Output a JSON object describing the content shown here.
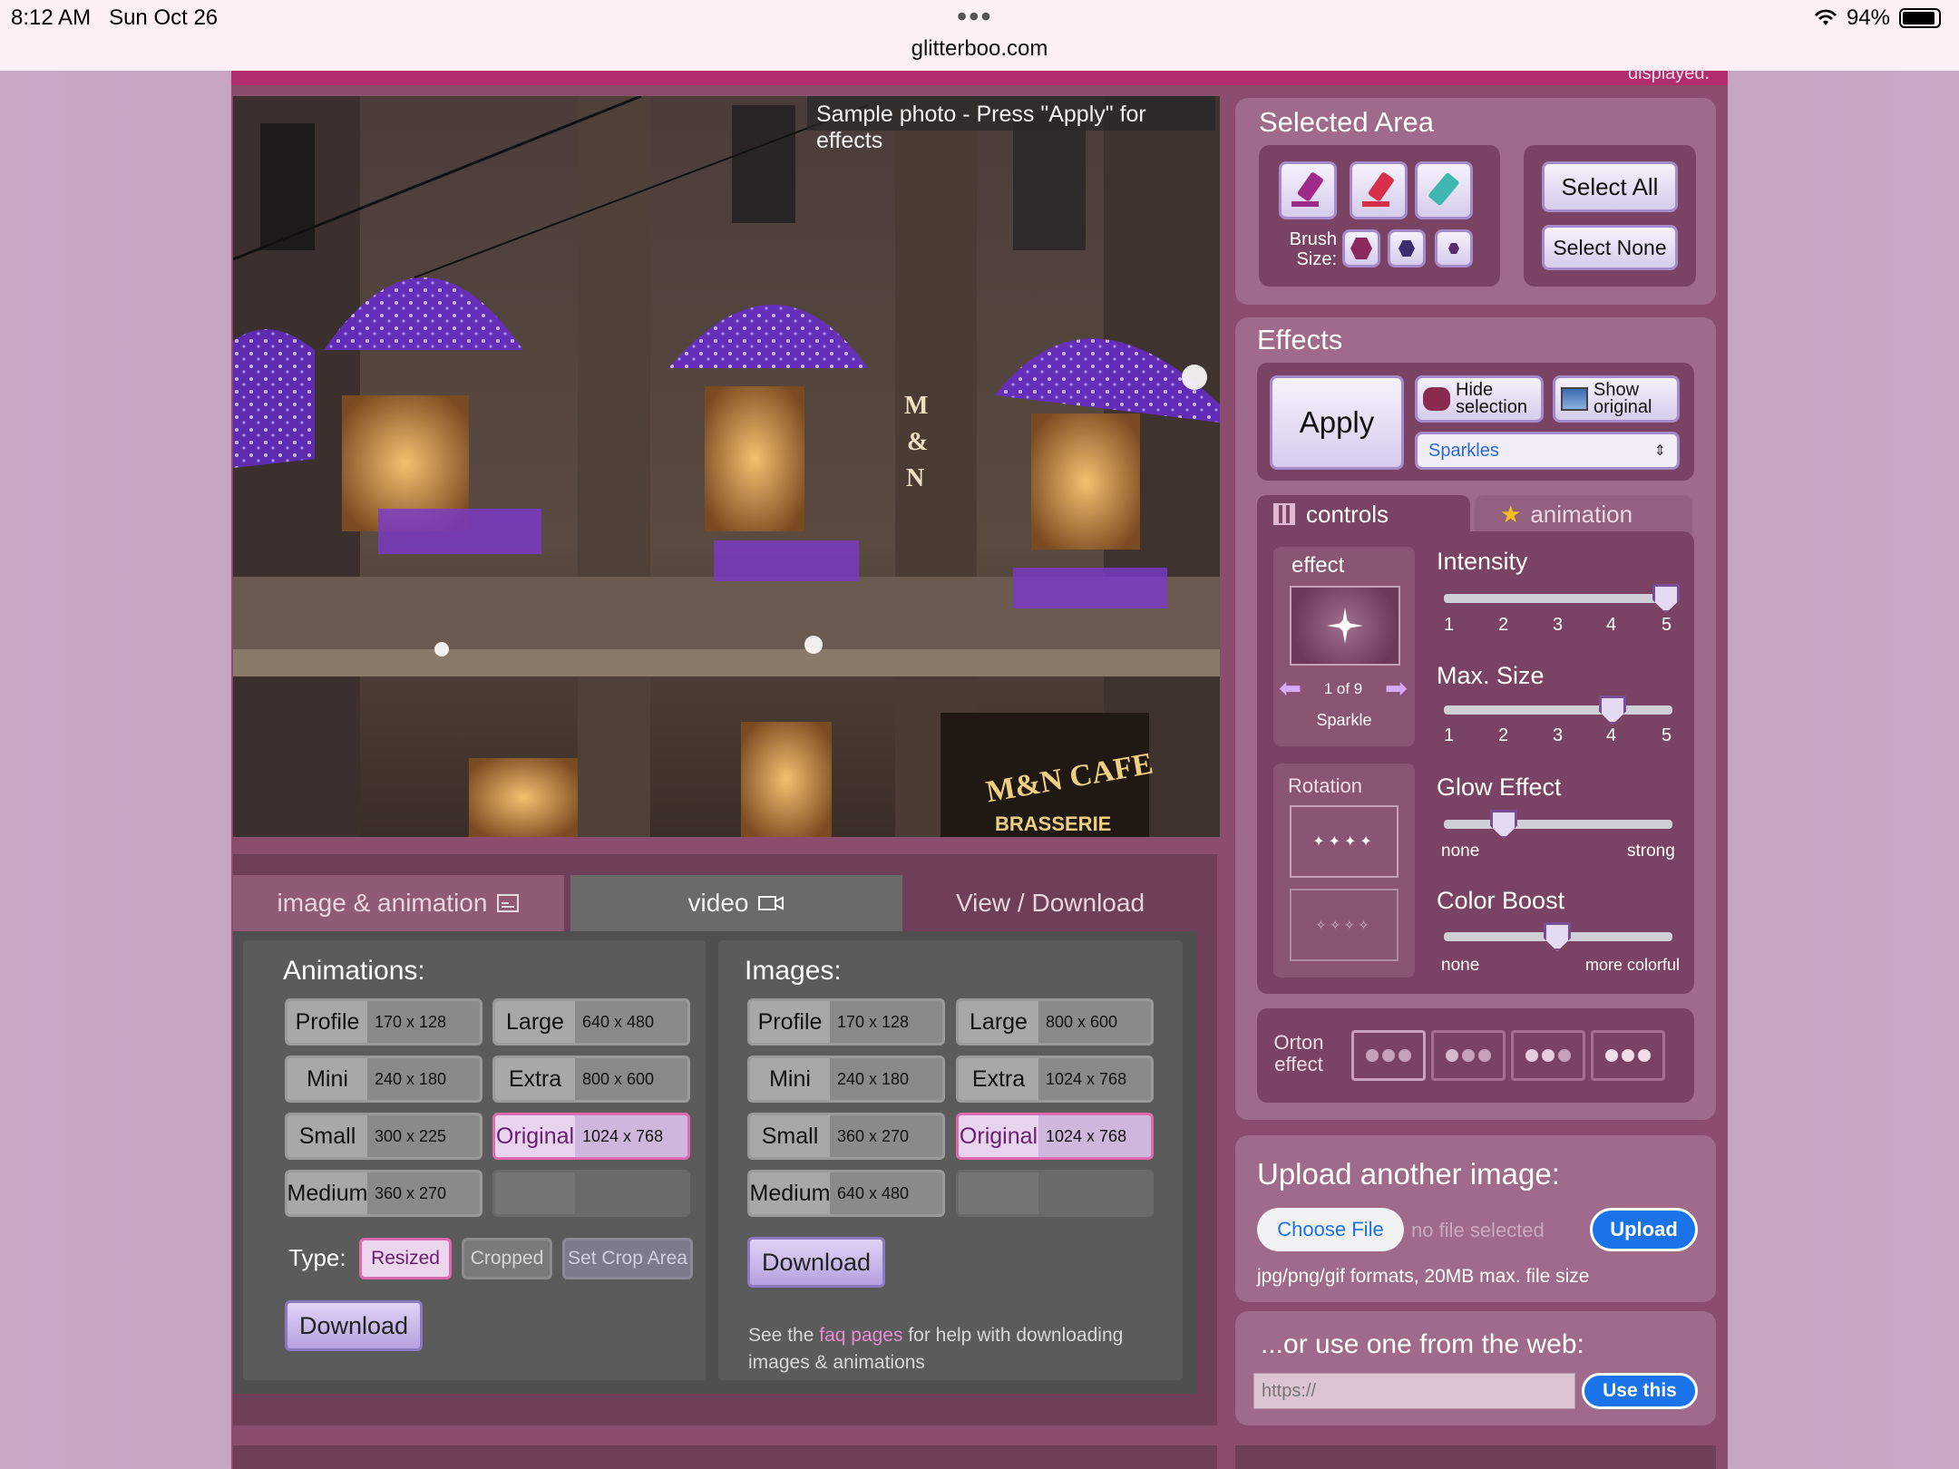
{
  "status_bar": {
    "time": "8:12 AM",
    "date": "Sun Oct 26",
    "dots": "•••",
    "url": "glitterboo.com",
    "battery": "94%"
  },
  "site": {
    "displayed_text": "displayed.",
    "photo_caption": "Sample photo - Press \"Apply\" for effects",
    "tabs": [
      {
        "label": "image & animation",
        "icon": "image-icon"
      },
      {
        "label": "video",
        "icon": "video-icon"
      },
      {
        "label": "View / Download"
      }
    ],
    "animations": {
      "heading": "Animations:",
      "sizes": [
        {
          "name": "Profile",
          "dims": "170 x 128"
        },
        {
          "name": "Large",
          "dims": "640 x 480"
        },
        {
          "name": "Mini",
          "dims": "240 x 180"
        },
        {
          "name": "Extra",
          "dims": "800 x 600"
        },
        {
          "name": "Small",
          "dims": "300 x 225"
        },
        {
          "name": "Original",
          "dims": "1024 x 768",
          "selected": true
        },
        {
          "name": "Medium",
          "dims": "360 x 270"
        }
      ],
      "type_label": "Type:",
      "types": [
        "Resized",
        "Cropped",
        "Set Crop Area"
      ],
      "selected_type": "Resized",
      "download": "Download"
    },
    "images": {
      "heading": "Images:",
      "sizes": [
        {
          "name": "Profile",
          "dims": "170 x 128"
        },
        {
          "name": "Large",
          "dims": "800 x 600"
        },
        {
          "name": "Mini",
          "dims": "240 x 180"
        },
        {
          "name": "Extra",
          "dims": "1024 x 768"
        },
        {
          "name": "Small",
          "dims": "360 x 270"
        },
        {
          "name": "Original",
          "dims": "1024 x 768",
          "selected": true
        },
        {
          "name": "Medium",
          "dims": "640 x 480"
        }
      ],
      "download": "Download",
      "help_prefix": "See the ",
      "help_link": "faq pages",
      "help_suffix": " for help with downloading",
      "help_line2": "images & animations"
    },
    "selected_area": {
      "title": "Selected Area",
      "brush_size_label_1": "Brush",
      "brush_size_label_2": "Size:",
      "select_all": "Select All",
      "select_none": "Select None"
    },
    "effects": {
      "title": "Effects",
      "apply": "Apply",
      "hide_selection_1": "Hide",
      "hide_selection_2": "selection",
      "show_original_1": "Show",
      "show_original_2": "original",
      "effect_select": "Sparkles",
      "tab_controls": "controls",
      "tab_animation": "animation",
      "effect_label": "effect",
      "effect_counter": "1 of 9",
      "effect_name": "Sparkle",
      "rotation_label": "Rotation",
      "intensity": {
        "label": "Intensity",
        "ticks": [
          "1",
          "2",
          "3",
          "4",
          "5"
        ],
        "value": 5
      },
      "max_size": {
        "label": "Max. Size",
        "ticks": [
          "1",
          "2",
          "3",
          "4",
          "5"
        ],
        "value": 4
      },
      "glow": {
        "label": "Glow Effect",
        "min": "none",
        "max": "strong",
        "value": 0.25
      },
      "color_boost": {
        "label": "Color Boost",
        "min": "none",
        "max": "more colorful",
        "value": 0.5
      },
      "orton_1": "Orton",
      "orton_2": "effect"
    },
    "upload": {
      "title": "Upload another image:",
      "choose": "Choose File",
      "no_file": "no file selected",
      "upload": "Upload",
      "formats": "jpg/png/gif formats,  20MB max. file size"
    },
    "web": {
      "title": "...or use one from the web:",
      "placeholder": "https://",
      "use_this": "Use this"
    },
    "colors": {
      "accent": "#b22c6e",
      "panel": "#8b4d6e",
      "link": "#e98bd2",
      "ios_blue": "#1a73e8"
    }
  }
}
